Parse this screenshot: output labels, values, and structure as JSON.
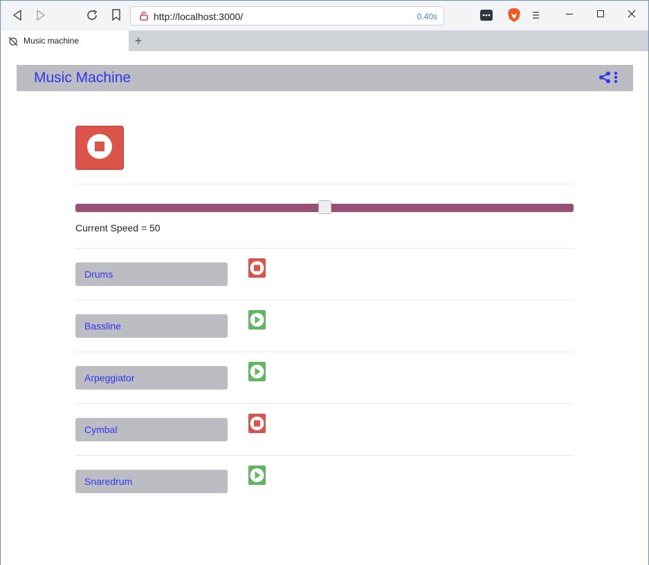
{
  "browser": {
    "url": "http://localhost:3000/",
    "load_time": "0.40s",
    "tab_title": "Music machine",
    "new_tab_glyph": "+"
  },
  "app": {
    "title": "Music Machine",
    "master_state": "playing",
    "speed_label": "Current Speed = 50",
    "speed_value": 50
  },
  "instruments": [
    {
      "label": "Drums",
      "state": "stop",
      "icon": "stop-icon"
    },
    {
      "label": "Bassline",
      "state": "play",
      "icon": "play-icon"
    },
    {
      "label": "Arpeggiator",
      "state": "play",
      "icon": "play-icon"
    },
    {
      "label": "Cymbal",
      "state": "stop",
      "icon": "stop-icon"
    },
    {
      "label": "Snaredrum",
      "state": "play",
      "icon": "play-icon"
    }
  ],
  "colors": {
    "accent_text": "#2f35f5",
    "stop_red": "#dc5349",
    "play_green": "#5cb85c",
    "slider_track": "#9b4f74",
    "navbar_bg": "#bcbdc3"
  }
}
